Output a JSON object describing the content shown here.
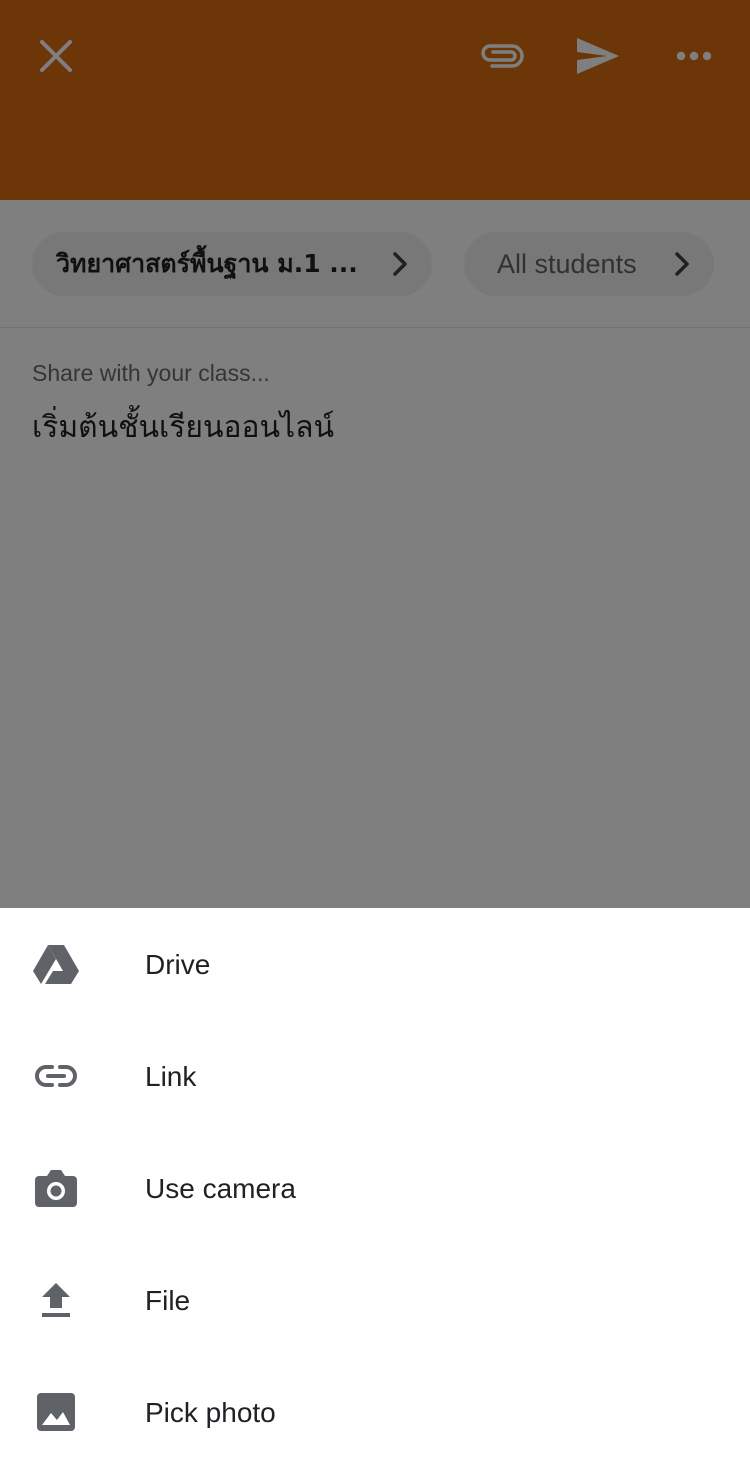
{
  "appbar": {
    "background_color": "#D96D10",
    "icons": {
      "close": "close-icon",
      "attach": "paperclip-icon",
      "send": "send-icon",
      "more": "more-horizontal-icon"
    }
  },
  "chips": {
    "class_label": "วิทยาศาสตร์พื้นฐาน ม.1 ...",
    "students_label": "All students"
  },
  "compose": {
    "placeholder": "Share with your class...",
    "text": "เริ่มต้นชั้นเรียนออนไลน์"
  },
  "attach_sheet": {
    "items": [
      {
        "label": "Drive",
        "icon": "drive-icon"
      },
      {
        "label": "Link",
        "icon": "link-icon"
      },
      {
        "label": "Use camera",
        "icon": "camera-icon"
      },
      {
        "label": "File",
        "icon": "upload-icon"
      },
      {
        "label": "Pick photo",
        "icon": "image-icon"
      }
    ]
  },
  "colors": {
    "icon_gray": "#5f6368",
    "scrim": "rgba(0,0,0,0.5)"
  }
}
